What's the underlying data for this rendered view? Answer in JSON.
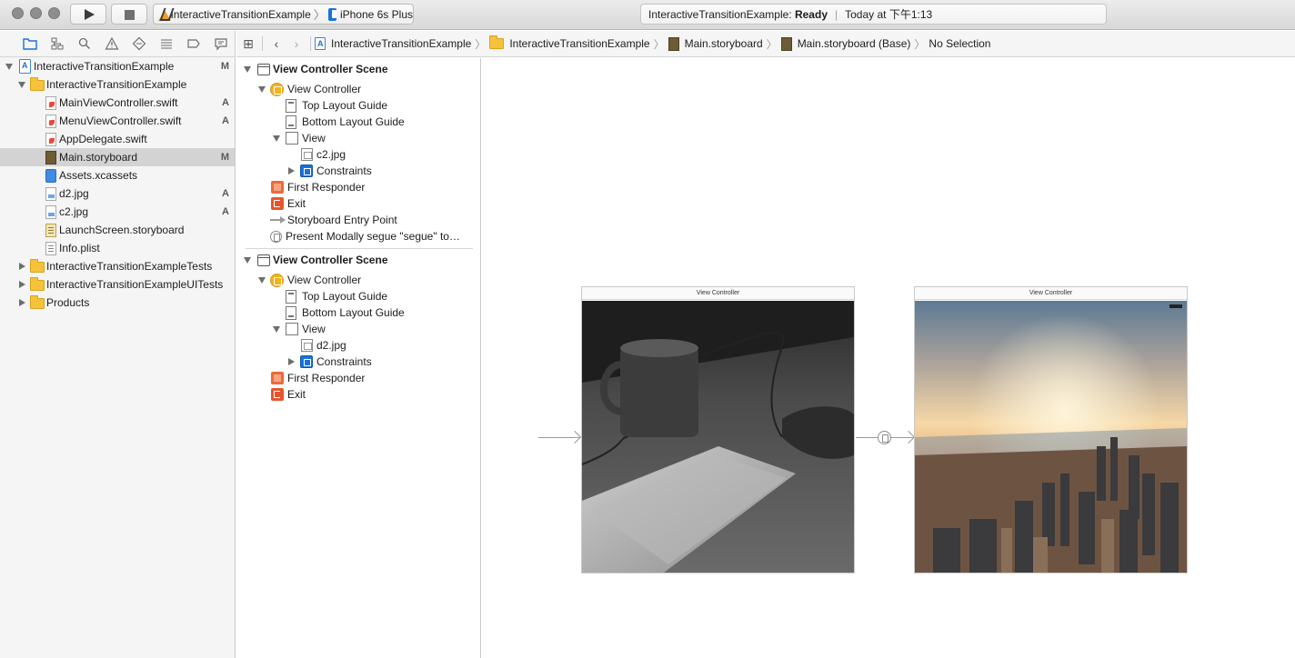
{
  "toolbar": {
    "scheme_target": "InteractiveTransitionExample",
    "device": "iPhone 6s Plus",
    "status_project": "InteractiveTransitionExample:",
    "status_state": "Ready",
    "status_time": "Today at 下午1:13"
  },
  "navigator": {
    "items": [
      {
        "label": "InteractiveTransitionExample",
        "status": "M"
      },
      {
        "label": "InteractiveTransitionExample",
        "status": ""
      },
      {
        "label": "MainViewController.swift",
        "status": "A"
      },
      {
        "label": "MenuViewController.swift",
        "status": "A"
      },
      {
        "label": "AppDelegate.swift",
        "status": ""
      },
      {
        "label": "Main.storyboard",
        "status": "M"
      },
      {
        "label": "Assets.xcassets",
        "status": ""
      },
      {
        "label": "d2.jpg",
        "status": "A"
      },
      {
        "label": "c2.jpg",
        "status": "A"
      },
      {
        "label": "LaunchScreen.storyboard",
        "status": ""
      },
      {
        "label": "Info.plist",
        "status": ""
      },
      {
        "label": "InteractiveTransitionExampleTests",
        "status": ""
      },
      {
        "label": "InteractiveTransitionExampleUITests",
        "status": ""
      },
      {
        "label": "Products",
        "status": ""
      }
    ]
  },
  "jumpbar": {
    "path": [
      "InteractiveTransitionExample",
      "InteractiveTransitionExample",
      "Main.storyboard",
      "Main.storyboard (Base)",
      "No Selection"
    ]
  },
  "outline": {
    "scene1": {
      "title": "View Controller Scene",
      "controller": "View Controller",
      "top_guide": "Top Layout Guide",
      "bottom_guide": "Bottom Layout Guide",
      "view": "View",
      "image": "c2.jpg",
      "constraints": "Constraints",
      "first_responder": "First Responder",
      "exit": "Exit",
      "entry_point": "Storyboard Entry Point",
      "segue": "Present Modally segue \"segue\" to…"
    },
    "scene2": {
      "title": "View Controller Scene",
      "controller": "View Controller",
      "top_guide": "Top Layout Guide",
      "bottom_guide": "Bottom Layout Guide",
      "view": "View",
      "image": "d2.jpg",
      "constraints": "Constraints",
      "first_responder": "First Responder",
      "exit": "Exit"
    }
  },
  "canvas": {
    "vc1_title": "View Controller",
    "vc2_title": "View Controller"
  }
}
